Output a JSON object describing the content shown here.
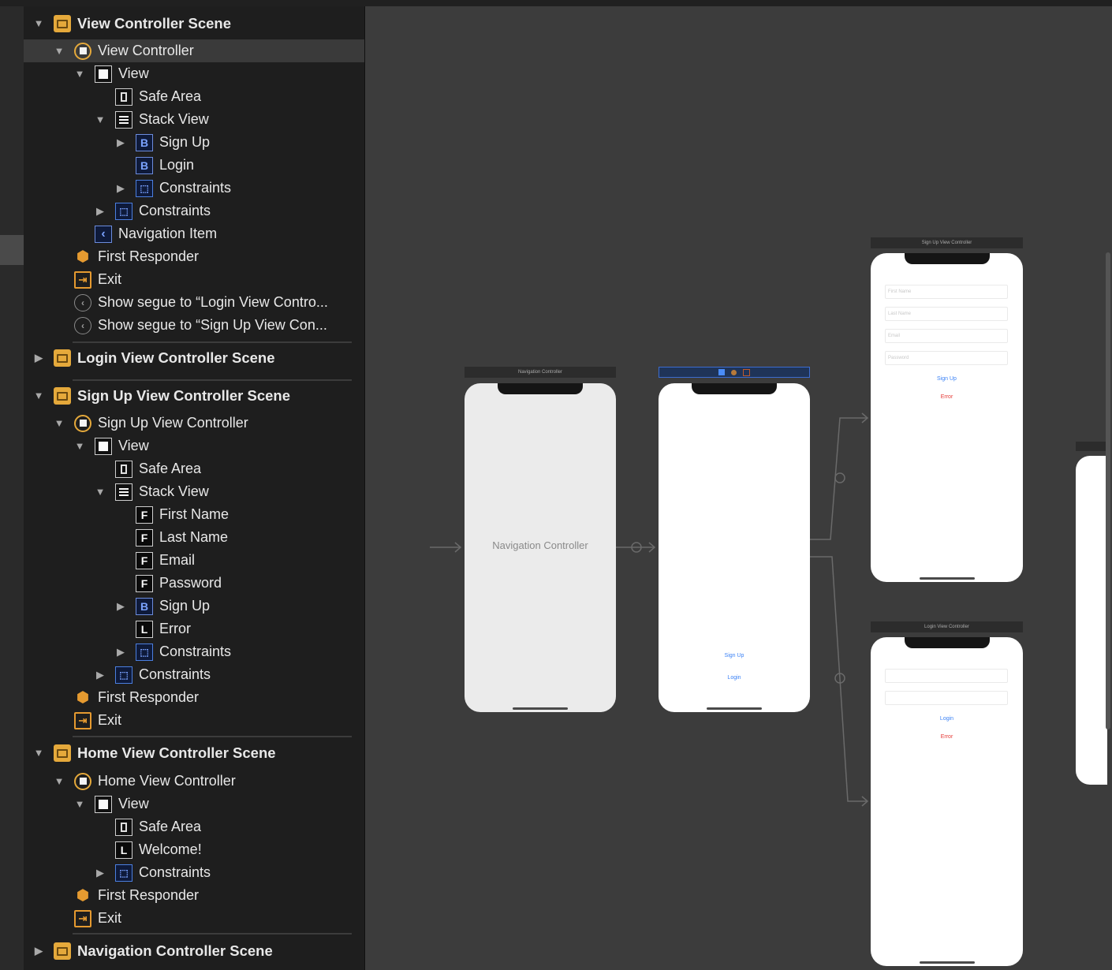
{
  "outline": {
    "rows": [
      {
        "label": "View Controller Scene",
        "icon": "scene-icon",
        "disclosure": "expanded"
      },
      {
        "label": "View Controller",
        "icon": "view-controller-icon",
        "disclosure": "expanded",
        "selected": true
      },
      {
        "label": "View",
        "icon": "view-icon",
        "disclosure": "expanded"
      },
      {
        "label": "Safe Area",
        "icon": "safe-area-icon"
      },
      {
        "label": "Stack View",
        "icon": "stack-view-icon",
        "disclosure": "expanded"
      },
      {
        "label": "Sign Up",
        "icon": "button-icon",
        "glyph": "B",
        "disclosure": "collapsed"
      },
      {
        "label": "Login",
        "icon": "button-icon",
        "glyph": "B"
      },
      {
        "label": "Constraints",
        "icon": "constraints-icon",
        "disclosure": "collapsed"
      },
      {
        "label": "Constraints",
        "icon": "constraints-icon",
        "disclosure": "collapsed"
      },
      {
        "label": "Navigation Item",
        "icon": "navigation-item-icon"
      },
      {
        "label": "First Responder",
        "icon": "first-responder-icon"
      },
      {
        "label": "Exit",
        "icon": "exit-icon"
      },
      {
        "label": "Show segue to “Login View Contro...",
        "icon": "segue-icon"
      },
      {
        "label": "Show segue to “Sign Up View Con...",
        "icon": "segue-icon"
      },
      {
        "label": "Login View Controller Scene",
        "icon": "scene-icon",
        "disclosure": "collapsed"
      },
      {
        "label": "Sign Up View Controller Scene",
        "icon": "scene-icon",
        "disclosure": "expanded"
      },
      {
        "label": "Sign Up View Controller",
        "icon": "view-controller-icon",
        "disclosure": "expanded"
      },
      {
        "label": "View",
        "icon": "view-icon",
        "disclosure": "expanded"
      },
      {
        "label": "Safe Area",
        "icon": "safe-area-icon"
      },
      {
        "label": "Stack View",
        "icon": "stack-view-icon",
        "disclosure": "expanded"
      },
      {
        "label": "First Name",
        "icon": "text-field-icon",
        "glyph": "F"
      },
      {
        "label": "Last Name",
        "icon": "text-field-icon",
        "glyph": "F"
      },
      {
        "label": "Email",
        "icon": "text-field-icon",
        "glyph": "F"
      },
      {
        "label": "Password",
        "icon": "text-field-icon",
        "glyph": "F"
      },
      {
        "label": "Sign Up",
        "icon": "button-icon",
        "glyph": "B",
        "disclosure": "collapsed"
      },
      {
        "label": "Error",
        "icon": "label-icon",
        "glyph": "L"
      },
      {
        "label": "Constraints",
        "icon": "constraints-icon",
        "disclosure": "collapsed"
      },
      {
        "label": "Constraints",
        "icon": "constraints-icon",
        "disclosure": "collapsed"
      },
      {
        "label": "First Responder",
        "icon": "first-responder-icon"
      },
      {
        "label": "Exit",
        "icon": "exit-icon"
      },
      {
        "label": "Home View Controller Scene",
        "icon": "scene-icon",
        "disclosure": "expanded"
      },
      {
        "label": "Home View Controller",
        "icon": "view-controller-icon",
        "disclosure": "expanded"
      },
      {
        "label": "View",
        "icon": "view-icon",
        "disclosure": "expanded"
      },
      {
        "label": "Safe Area",
        "icon": "safe-area-icon"
      },
      {
        "label": "Welcome!",
        "icon": "label-icon",
        "glyph": "L"
      },
      {
        "label": "Constraints",
        "icon": "constraints-icon",
        "disclosure": "collapsed"
      },
      {
        "label": "First Responder",
        "icon": "first-responder-icon"
      },
      {
        "label": "Exit",
        "icon": "exit-icon"
      },
      {
        "label": "Navigation Controller Scene",
        "icon": "scene-icon",
        "disclosure": "collapsed"
      }
    ]
  },
  "canvas": {
    "nav_controller": {
      "title": "Navigation Controller",
      "center_label": "Navigation Controller"
    },
    "view_controller": {
      "signup_link": "Sign Up",
      "login_link": "Login"
    },
    "signup_vc": {
      "title": "Sign Up View Controller",
      "fields": [
        "First Name",
        "Last Name",
        "Email",
        "Password"
      ],
      "button": "Sign Up",
      "error": "Error"
    },
    "login_vc": {
      "title": "Login View Controller",
      "button": "Login",
      "error": "Error"
    }
  },
  "colors": {
    "accent_scene": "#e5a93b",
    "link_blue": "#3b82f6",
    "error_red": "#e53935"
  }
}
